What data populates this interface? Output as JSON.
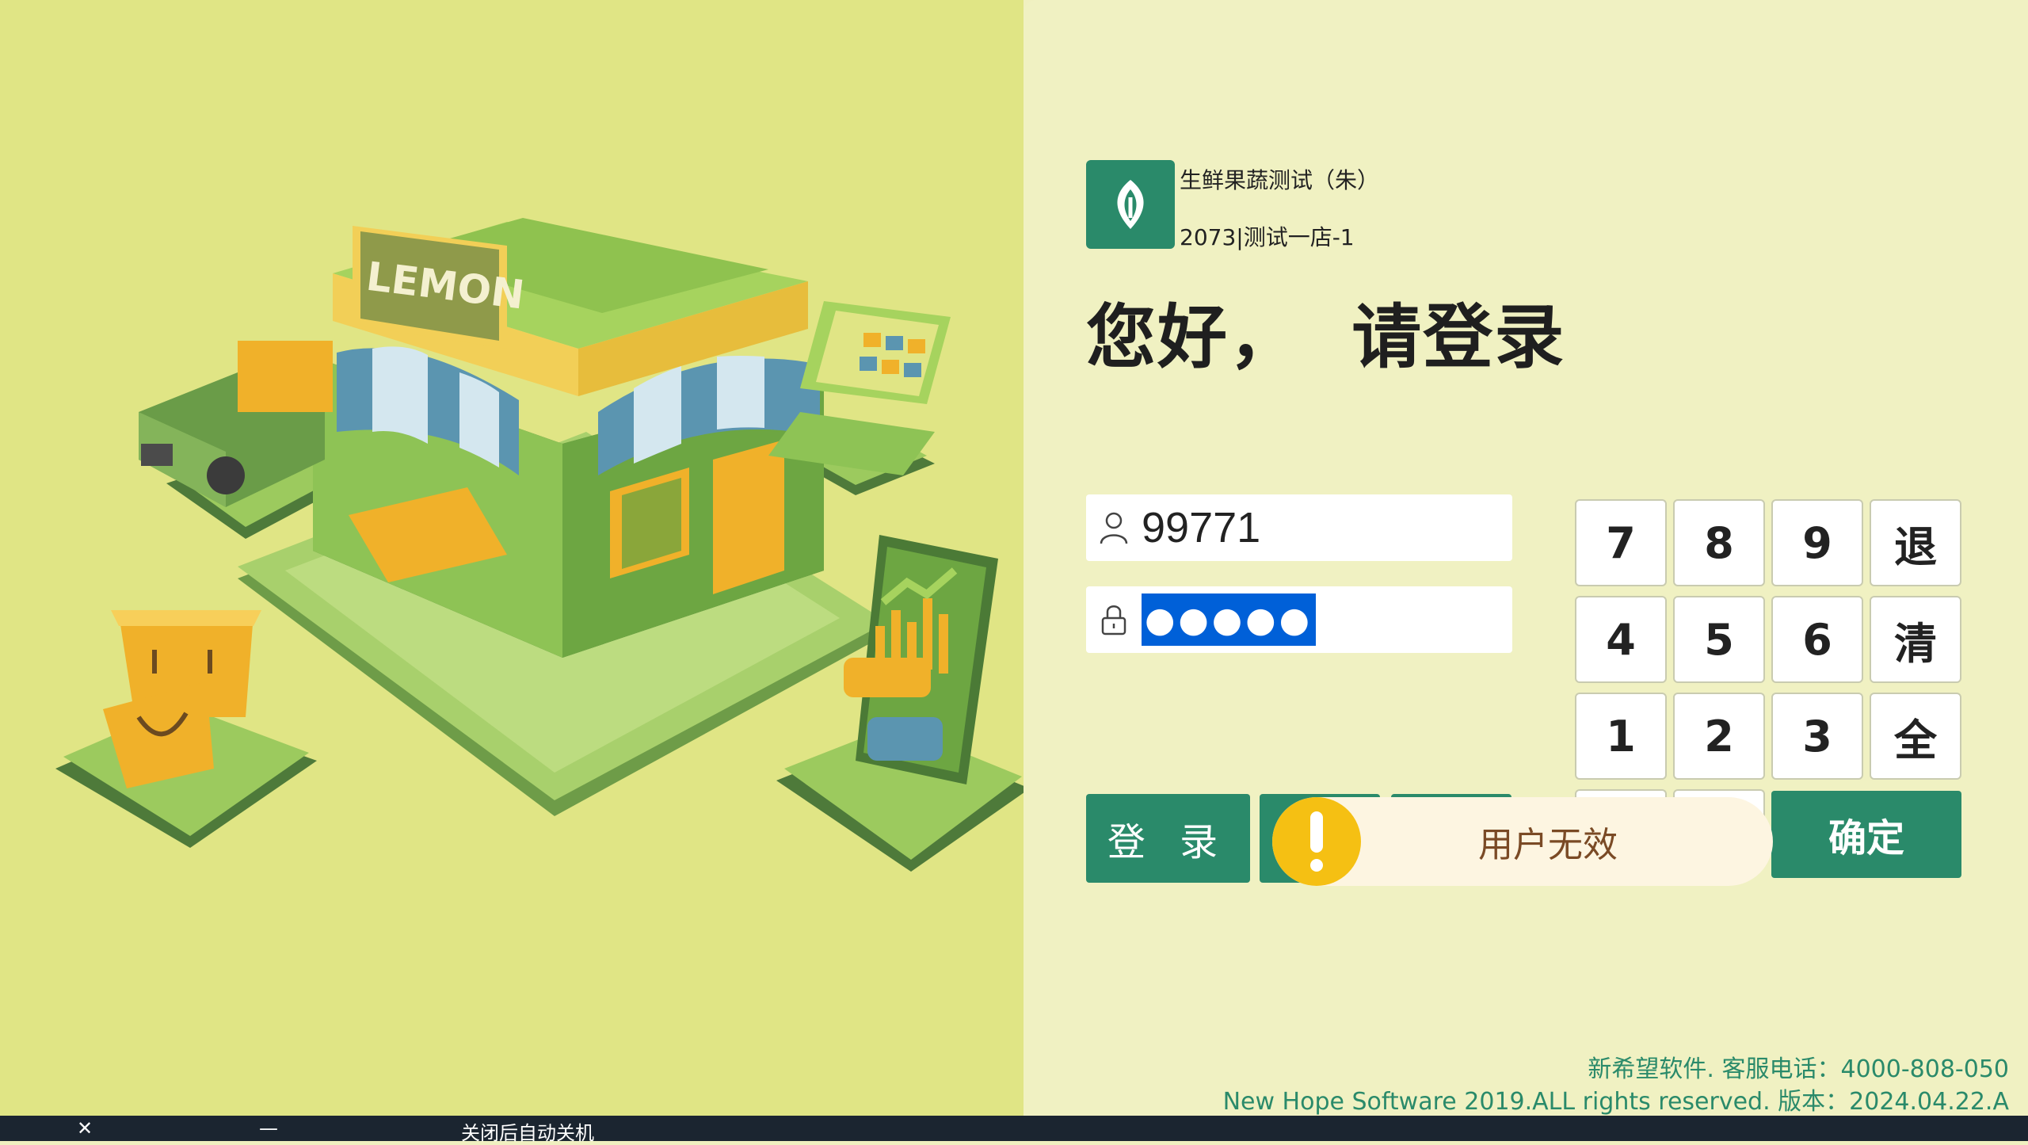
{
  "brand": {
    "store_name": "生鲜果蔬测试（朱）",
    "store_code": "2073|测试一店-1",
    "accent_color": "#2a8a6a"
  },
  "illustration": {
    "sign_text": "LEMON",
    "icon": "storefront-illustration"
  },
  "greeting": "您好，  请登录",
  "login": {
    "username_value": "99771",
    "password_masked": "●●●●●",
    "username_icon": "user-icon",
    "password_icon": "lock-icon",
    "submit_label": "登 录"
  },
  "keypad": {
    "rows": [
      [
        "7",
        "8",
        "9",
        "退"
      ],
      [
        "4",
        "5",
        "6",
        "清"
      ],
      [
        "1",
        "2",
        "3",
        "全"
      ]
    ],
    "confirm_label": "确定"
  },
  "toast": {
    "message": "用户无效",
    "icon": "warning-icon",
    "color": "#f5c013"
  },
  "footer": {
    "line1": "新希望软件. 客服电话：4000-808-050",
    "line2": "New Hope Software 2019.ALL rights reserved. 版本：2024.04.22.A"
  },
  "taskbar": {
    "close_symbol": "✕",
    "minimize_symbol": "—",
    "auto_shutdown_label": "关闭后自动关机"
  }
}
